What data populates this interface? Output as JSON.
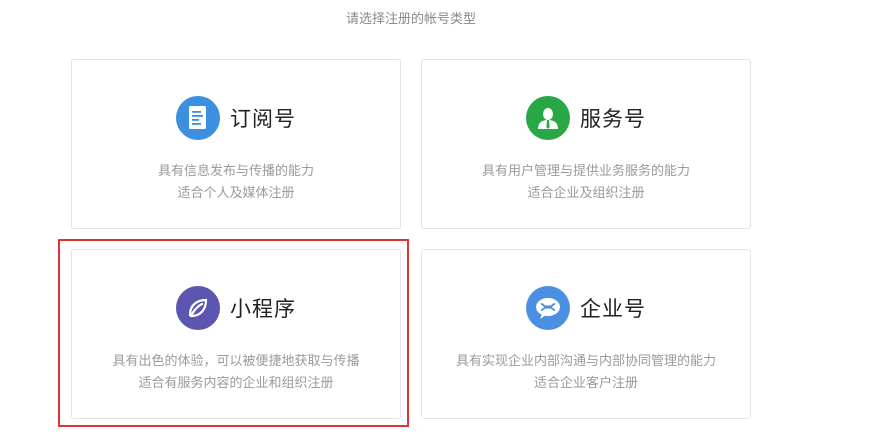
{
  "prompt": "请选择注册的帐号类型",
  "cards": [
    {
      "title": "订阅号",
      "icon": "document-icon",
      "icon_color": "#3d8fe0",
      "desc1": "具有信息发布与传播的能力",
      "desc2": "适合个人及媒体注册"
    },
    {
      "title": "服务号",
      "icon": "person-icon",
      "icon_color": "#28a745",
      "desc1": "具有用户管理与提供业务服务的能力",
      "desc2": "适合企业及组织注册"
    },
    {
      "title": "小程序",
      "icon": "mini-program-icon",
      "icon_color": "#5d56b0",
      "desc1": "具有出色的体验，可以被便捷地获取与传播",
      "desc2": "适合有服务内容的企业和组织注册"
    },
    {
      "title": "企业号",
      "icon": "enterprise-chat-icon",
      "icon_color": "#4a8fe0",
      "desc1": "具有实现企业内部沟通与内部协同管理的能力",
      "desc2": "适合企业客户注册"
    }
  ],
  "highlight_color": "#e03434"
}
